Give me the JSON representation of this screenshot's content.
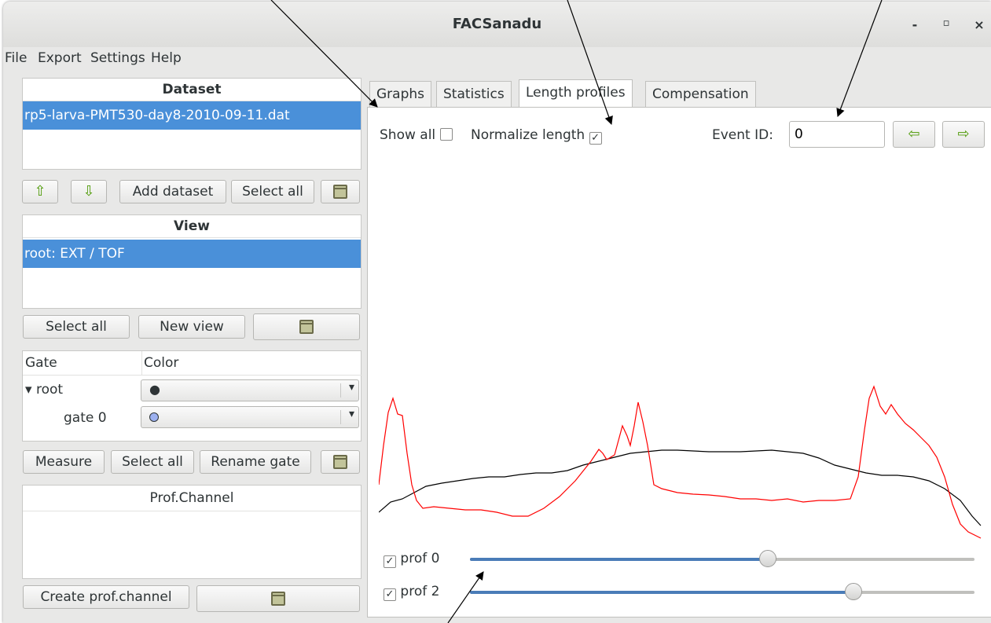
{
  "window": {
    "title": "FACSanadu",
    "minimize": "-",
    "maximize": "▫",
    "close": "×"
  },
  "menu": [
    "File",
    "Export",
    "Settings",
    "Help"
  ],
  "dataset": {
    "header": "Dataset",
    "items": [
      "rp5-larva-PMT530-day8-2010-09-11.dat"
    ],
    "add_label": "Add dataset",
    "select_all_label": "Select all"
  },
  "view": {
    "header": "View",
    "items": [
      "root: EXT / TOF"
    ],
    "select_all_label": "Select all",
    "new_view_label": "New view"
  },
  "gates": {
    "columns": [
      "Gate",
      "Color"
    ],
    "rows": [
      {
        "name": "root",
        "color_symbol": "●",
        "expander": "▾"
      },
      {
        "name": "gate 0",
        "color_symbol": "○",
        "color": "#9db1f0"
      }
    ],
    "measure_label": "Measure",
    "select_all_label": "Select all",
    "rename_label": "Rename gate"
  },
  "prof_channel": {
    "header": "Prof.Channel",
    "create_label": "Create prof.channel"
  },
  "tabs": [
    {
      "label": "Graphs",
      "active": false
    },
    {
      "label": "Statistics",
      "active": false
    },
    {
      "label": "Length profiles",
      "active": true
    },
    {
      "label": "Compensation",
      "active": false
    }
  ],
  "length_profiles": {
    "show_all_label": "Show all",
    "show_all_checked": false,
    "normalize_label": "Normalize length",
    "normalize_checked": true,
    "event_id_label": "Event ID:",
    "event_id_value": "0",
    "prev_icon": "arrow-left-icon",
    "next_icon": "arrow-right-icon",
    "profiles": [
      {
        "label": "prof 0",
        "checked": true,
        "level": 0.59,
        "color": "#000000"
      },
      {
        "label": "prof 2",
        "checked": true,
        "level": 0.76,
        "color": "#ff0000"
      }
    ]
  },
  "colors": {
    "selection": "#4a90d9",
    "slider": "#4a7cb8",
    "arrow_green": "#4e9a06"
  }
}
